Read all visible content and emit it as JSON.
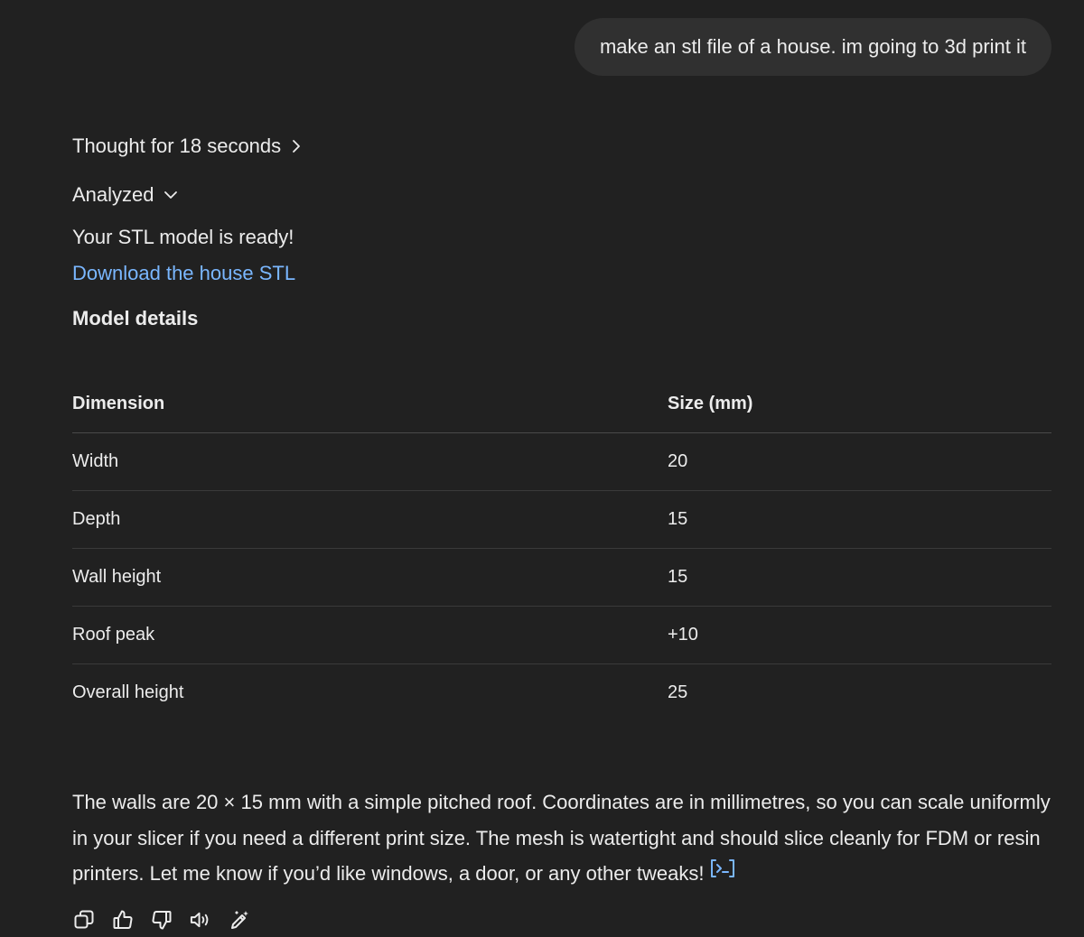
{
  "user_message": {
    "text": "make an stl file of a house. im going to 3d print it"
  },
  "assistant": {
    "thought_label": "Thought for 18 seconds",
    "analyzed_label": "Analyzed",
    "ready_text": "Your STL model is ready!",
    "download_link": "Download the house STL",
    "details_heading": "Model details",
    "table": {
      "headers": [
        "Dimension",
        "Size (mm)"
      ],
      "rows": [
        [
          "Width",
          "20"
        ],
        [
          "Depth",
          "15"
        ],
        [
          "Wall height",
          "15"
        ],
        [
          "Roof peak",
          "+10"
        ],
        [
          "Overall height",
          "25"
        ]
      ]
    },
    "paragraph": "The walls are 20 × 15 mm with a simple pitched roof. Coordinates are in millimetres, so you can scale uniformly in your slicer if you need a different print size. The mesh is watertight and should slice cleanly for FDM or resin printers. Let me know if you’d like windows, a door, or any other tweaks!",
    "actions": [
      {
        "icon": "copy-icon"
      },
      {
        "icon": "thumbs-up-icon"
      },
      {
        "icon": "thumbs-down-icon"
      },
      {
        "icon": "read-aloud-icon"
      },
      {
        "icon": "edit-wand-icon"
      }
    ]
  },
  "colors": {
    "background": "#212121",
    "bubble": "#303030",
    "text": "#ececec",
    "link": "#7ab7ff"
  }
}
